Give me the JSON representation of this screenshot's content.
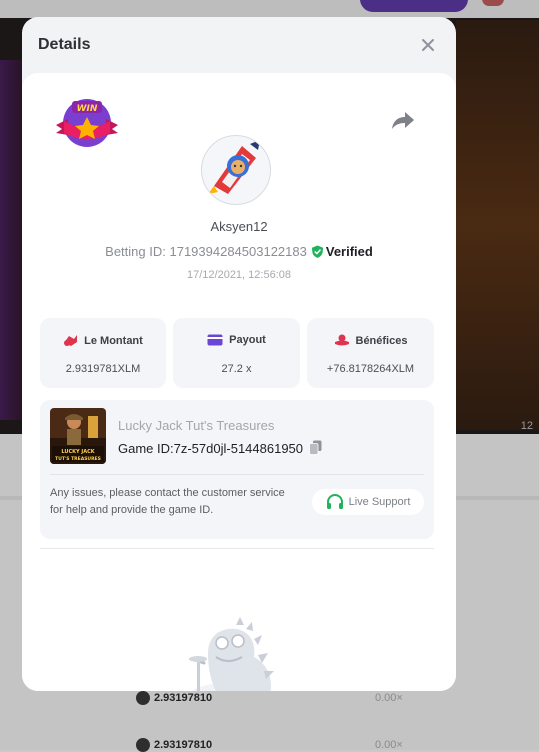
{
  "background": {
    "corner_number": "12",
    "rows": [
      {
        "amount": "2.93197810",
        "multiplier": "0.00×"
      },
      {
        "amount": "2.93197810",
        "multiplier": "0.00×"
      }
    ]
  },
  "modal": {
    "title": "Details",
    "user": {
      "username": "Aksyen12",
      "betting_id_label": "Betting ID:",
      "betting_id": "1719394284503122183",
      "verified_label": "Verified",
      "timestamp": "17/12/2021, 12:56:08"
    },
    "stats": [
      {
        "label": "Le Montant",
        "value": "2.9319781XLM",
        "icon": "bet-icon"
      },
      {
        "label": "Payout",
        "value": "27.2 x",
        "icon": "payout-card-icon"
      },
      {
        "label": "Bénéfices",
        "value": "+76.8178264XLM",
        "icon": "profit-icon"
      }
    ],
    "game": {
      "name": "Lucky Jack Tut's Treasures",
      "id_label": "Game ID:",
      "id": "7z-57d0jl-5144861950",
      "thumb_text": "LUCKY JACK TUT'S TREASURES"
    },
    "support": {
      "message": "Any issues, please contact the customer service for help and provide the game ID.",
      "button_label": "Live Support"
    },
    "colors": {
      "accent_red": "#e0334d",
      "verified_green": "#20b35b",
      "payout_purple": "#6b46d6"
    }
  }
}
